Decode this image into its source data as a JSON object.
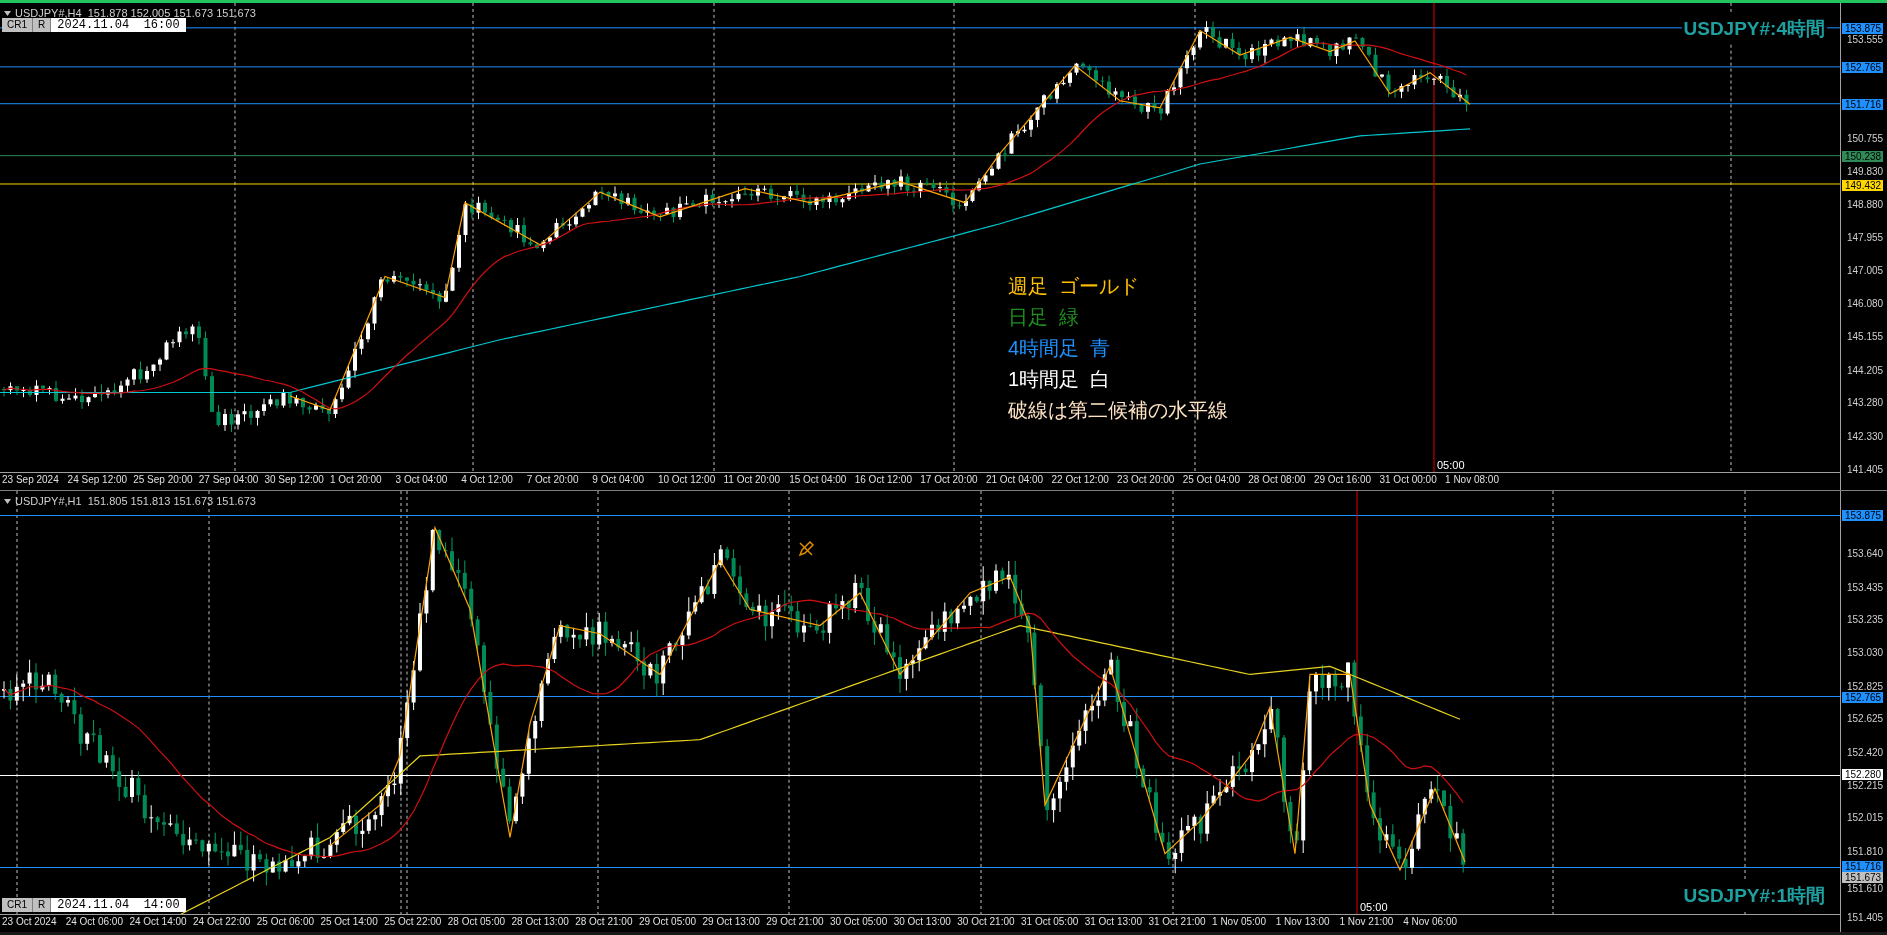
{
  "charts": [
    {
      "selected": true,
      "header": "USDJPY#,H4  151.878 152.005 151.673 151.673",
      "date_bar": {
        "buttons": [
          "CR1",
          "R"
        ],
        "value": "2024.11.04  16:00"
      },
      "watermark": "USDJPY#:4時間",
      "legend": [
        {
          "text": "週足  ゴールド",
          "color": "#ffc000"
        },
        {
          "text": "日足  緑",
          "color": "#1f8f1f"
        },
        {
          "text": "4時間足  青",
          "color": "#1e90ff"
        },
        {
          "text": "1時間足  白",
          "color": "#ffffff"
        },
        {
          "text": "破線は第二候補の水平線",
          "color": "#ffe4c4"
        }
      ],
      "price_axis": {
        "ticks": [
          "153.555",
          "150.755",
          "149.830",
          "148.880",
          "147.955",
          "147.005",
          "146.080",
          "145.155",
          "144.205",
          "143.280",
          "142.330",
          "141.405"
        ],
        "badges": [
          {
            "value": "153.875",
            "color": "#1e90ff",
            "kind": "level"
          },
          {
            "value": "152.765",
            "color": "#1e90ff",
            "kind": "level"
          },
          {
            "value": "151.716",
            "color": "#1e90ff",
            "kind": "level"
          },
          {
            "value": "150.238",
            "color": "#2e8b57",
            "kind": "level"
          },
          {
            "value": "149.432",
            "color": "#ffd700",
            "kind": "level"
          }
        ]
      },
      "time_axis": {
        "labels": [
          "23 Sep 2024",
          "24 Sep 12:00",
          "25 Sep 20:00",
          "27 Sep 04:00",
          "30 Sep 12:00",
          "1 Oct 20:00",
          "3 Oct 04:00",
          "4 Oct 12:00",
          "7 Oct 20:00",
          "9 Oct 04:00",
          "10 Oct 12:00",
          "11 Oct 20:00",
          "15 Oct 04:00",
          "16 Oct 12:00",
          "17 Oct 20:00",
          "21 Oct 04:00",
          "22 Oct 12:00",
          "23 Oct 20:00",
          "25 Oct 04:00",
          "28 Oct 08:00",
          "29 Oct 16:00",
          "31 Oct 00:00",
          "1 Nov 08:00"
        ],
        "marker": "05:00"
      }
    },
    {
      "selected": false,
      "header": "USDJPY#,H1  151.805 151.813 151.673 151.673",
      "footer_date_bar": {
        "buttons": [
          "CR1",
          "R"
        ],
        "value": "2024.11.04  14:00"
      },
      "watermark": "USDJPY#:1時間",
      "price_axis": {
        "ticks": [
          "153.640",
          "153.435",
          "153.235",
          "153.030",
          "152.825",
          "152.625",
          "152.420",
          "152.215",
          "152.015",
          "151.810",
          "151.610",
          "151.405"
        ],
        "badges": [
          {
            "value": "153.875",
            "color": "#1e90ff",
            "kind": "level"
          },
          {
            "value": "152.765",
            "color": "#1e90ff",
            "kind": "level"
          },
          {
            "value": "152.280",
            "color": "#ffffff",
            "kind": "level"
          },
          {
            "value": "151.716",
            "color": "#1e90ff",
            "kind": "level"
          },
          {
            "value": "151.673",
            "color": "#c0c0c0",
            "kind": "price"
          }
        ]
      },
      "time_axis": {
        "labels": [
          "23 Oct 2024",
          "24 Oct 06:00",
          "24 Oct 14:00",
          "24 Oct 22:00",
          "25 Oct 06:00",
          "25 Oct 14:00",
          "25 Oct 22:00",
          "28 Oct 05:00",
          "28 Oct 13:00",
          "28 Oct 21:00",
          "29 Oct 05:00",
          "29 Oct 13:00",
          "29 Oct 21:00",
          "30 Oct 05:00",
          "30 Oct 13:00",
          "30 Oct 21:00",
          "31 Oct 05:00",
          "31 Oct 13:00",
          "31 Oct 21:00",
          "1 Nov 05:00",
          "1 Nov 13:00",
          "1 Nov 21:00",
          "4 Nov 06:00"
        ],
        "marker": "05:00"
      }
    }
  ]
}
